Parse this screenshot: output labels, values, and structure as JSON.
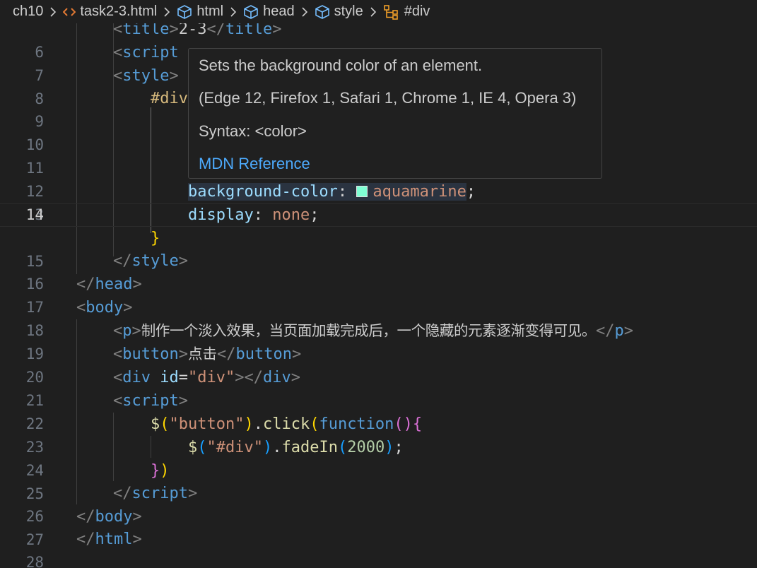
{
  "breadcrumb": {
    "items": [
      {
        "label": "ch10",
        "icon": "folder"
      },
      {
        "label": "task2-3.html",
        "icon": "html-file-icon"
      },
      {
        "label": "html",
        "icon": "cube-icon"
      },
      {
        "label": "head",
        "icon": "cube-icon"
      },
      {
        "label": "style",
        "icon": "cube-icon"
      },
      {
        "label": "#div",
        "icon": "selector-icon"
      }
    ]
  },
  "editor": {
    "current_line": 14,
    "line_numbers": [
      "6",
      "7",
      "8",
      "9",
      "10",
      "11",
      "12",
      "13",
      "14",
      "15",
      "16",
      "17",
      "18",
      "19",
      "20",
      "21",
      "22",
      "23",
      "24",
      "25",
      "26",
      "27",
      "28"
    ]
  },
  "code": {
    "l6": {
      "open": "<",
      "tag": "title",
      "close": ">",
      "text": "2-3",
      "endopen": "</",
      "endtag": "title",
      "endclose": ">"
    },
    "l7": {
      "open": "<",
      "tag": "script"
    },
    "l8": {
      "open": "<",
      "tag": "style",
      "close": ">"
    },
    "l9": {
      "sel": "#div"
    },
    "l13": {
      "prop": "background-color",
      "colon": ":",
      "val": "aquamarine",
      "semi": ";"
    },
    "l14": {
      "prop": "display",
      "colon": ":",
      "val": "none",
      "semi": ";"
    },
    "l15": {
      "brace": "}"
    },
    "l16": {
      "open": "</",
      "tag": "style",
      "close": ">"
    },
    "l17": {
      "open": "</",
      "tag": "head",
      "close": ">"
    },
    "l18": {
      "open": "<",
      "tag": "body",
      "close": ">"
    },
    "l19": {
      "open": "<",
      "tag": "p",
      "close": ">",
      "text": "制作一个淡入效果，当页面加载完成后，一个隐藏的元素逐渐变得可见。",
      "endopen": "</",
      "endtag": "p",
      "endclose": ">"
    },
    "l20": {
      "open": "<",
      "tag": "button",
      "close": ">",
      "text": "点击",
      "endopen": "</",
      "endtag": "button",
      "endclose": ">"
    },
    "l21": {
      "open": "<",
      "tag": "div",
      "attr": "id",
      "eq": "=",
      "str": "\"div\"",
      "close": ">",
      "endopen": "</",
      "endtag": "div",
      "endclose": ">"
    },
    "l22": {
      "open": "<",
      "tag": "script",
      "close": ">"
    },
    "l23": {
      "dollar": "$",
      "p1": "(",
      "str": "\"button\"",
      "p2": ")",
      "dot": ".",
      "fn": "click",
      "p3": "(",
      "kw": "function",
      "p4": "()",
      "brace": "{"
    },
    "l24": {
      "dollar": "$",
      "p1": "(",
      "str": "\"#div\"",
      "p2": ")",
      "dot": ".",
      "fn": "fadeIn",
      "p3": "(",
      "num": "2000",
      "p4": ")",
      "semi": ";"
    },
    "l25": {
      "brace": "}",
      "paren": ")"
    },
    "l26": {
      "open": "</",
      "tag": "script",
      "close": ">"
    },
    "l27": {
      "open": "</",
      "tag": "body",
      "close": ">"
    },
    "l28": {
      "open": "</",
      "tag": "html",
      "close": ">"
    }
  },
  "hover": {
    "description": "Sets the background color of an element.",
    "compat": "(Edge 12, Firefox 1, Safari 1, Chrome 1, IE 4, Opera 3)",
    "syntax": "Syntax: <color>",
    "link": "MDN Reference"
  },
  "colors": {
    "background": "#1f1f1f",
    "swatch": "#7fffd4",
    "link": "#4daafc"
  }
}
